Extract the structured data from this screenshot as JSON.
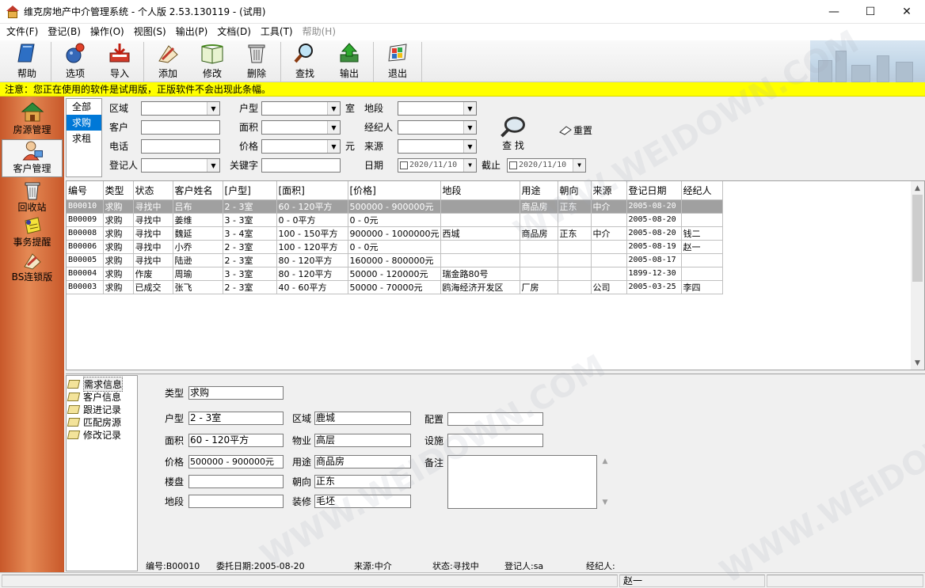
{
  "window": {
    "title": "维克房地产中介管理系统 - 个人版 2.53.130119 - (试用)",
    "minimize": "—",
    "maximize": "☐",
    "close": "✕"
  },
  "menu": [
    "文件(F)",
    "登记(B)",
    "操作(O)",
    "视图(S)",
    "输出(P)",
    "文档(D)",
    "工具(T)",
    "帮助(H)"
  ],
  "toolbar": {
    "help": "帮助",
    "options": "选项",
    "import": "导入",
    "add": "添加",
    "edit": "修改",
    "delete": "删除",
    "search": "查找",
    "output": "输出",
    "exit": "退出"
  },
  "notice": "注意：您正在使用的软件是试用版，正版软件不会出现此条幅。",
  "leftnav": {
    "property": "房源管理",
    "customer": "客户管理",
    "recycle": "回收站",
    "reminder": "事务提醒",
    "bs": "BS连锁版"
  },
  "categories": [
    "全部",
    "求购",
    "求租"
  ],
  "filter": {
    "region": "区域",
    "layout": "户型",
    "room_unit": "室",
    "lot": "地段",
    "customer": "客户",
    "area": "面积",
    "agent": "经纪人",
    "phone": "电话",
    "price": "价格",
    "yuan_unit": "元",
    "source": "来源",
    "registrar": "登记人",
    "keyword": "关键字",
    "date": "日期",
    "until": "截止",
    "date_from": "2020/11/10",
    "date_to": "2020/11/10",
    "search": "查 找",
    "reset": "重置"
  },
  "grid": {
    "headers": [
      "编号",
      "类型",
      "状态",
      "客户姓名",
      "[户型]",
      "[面积]",
      "[价格]",
      "地段",
      "用途",
      "朝向",
      "来源",
      "登记日期",
      "经纪人"
    ],
    "rows": [
      [
        "B00010",
        "求购",
        "寻找中",
        "吕布",
        "2 - 3室",
        "60 - 120平方",
        "500000 - 900000元",
        "",
        "商品房",
        "正东",
        "中介",
        "2005-08-20",
        ""
      ],
      [
        "B00009",
        "求购",
        "寻找中",
        "姜维",
        "3 - 3室",
        "0 - 0平方",
        "0 - 0元",
        "",
        "",
        "",
        "",
        "2005-08-20",
        ""
      ],
      [
        "B00008",
        "求购",
        "寻找中",
        "魏延",
        "3 - 4室",
        "100 - 150平方",
        "900000 - 1000000元",
        "西城",
        "商品房",
        "正东",
        "中介",
        "2005-08-20",
        "钱二"
      ],
      [
        "B00006",
        "求购",
        "寻找中",
        "小乔",
        "2 - 3室",
        "100 - 120平方",
        "0 - 0元",
        "",
        "",
        "",
        "",
        "2005-08-19",
        "赵一"
      ],
      [
        "B00005",
        "求购",
        "寻找中",
        "陆逊",
        "2 - 3室",
        "80 - 120平方",
        "160000 - 800000元",
        "",
        "",
        "",
        "",
        "2005-08-17",
        ""
      ],
      [
        "B00004",
        "求购",
        "作废",
        "周瑜",
        "3 - 3室",
        "80 - 120平方",
        "50000 - 120000元",
        "瑞金路80号",
        "",
        "",
        "",
        "1899-12-30",
        ""
      ],
      [
        "B00003",
        "求购",
        "已成交",
        "张飞",
        "2 - 3室",
        "40 - 60平方",
        "50000 - 70000元",
        "鸥海经济开发区",
        "厂房",
        "",
        "公司",
        "2005-03-25",
        "李四"
      ]
    ]
  },
  "tree": [
    "需求信息",
    "客户信息",
    "跟进记录",
    "匹配房源",
    "修改记录"
  ],
  "detail": {
    "labels": {
      "type": "类型",
      "layout": "户型",
      "region": "区域",
      "config": "配置",
      "area": "面积",
      "property": "物业",
      "facility": "设施",
      "price": "价格",
      "usage": "用途",
      "remark": "备注",
      "building": "楼盘",
      "orientation": "朝向",
      "lot": "地段",
      "decoration": "装修"
    },
    "values": {
      "type": "求购",
      "layout": "2 - 3室",
      "region": "鹿城",
      "config": "",
      "area": "60 - 120平方",
      "property": "高层",
      "facility": "",
      "price": "500000 - 900000元",
      "usage": "商品房",
      "building": "",
      "orientation": "正东",
      "lot": "",
      "decoration": "毛坯"
    },
    "info": {
      "code": "编号:B00010",
      "date": "委托日期:2005-08-20",
      "source": "来源:中介",
      "status": "状态:寻找中",
      "registrar": "登记人:sa",
      "agent": "经纪人:"
    }
  },
  "statusbar": {
    "user": "赵一"
  },
  "watermark": "WWW.WEIDOWN.COM"
}
